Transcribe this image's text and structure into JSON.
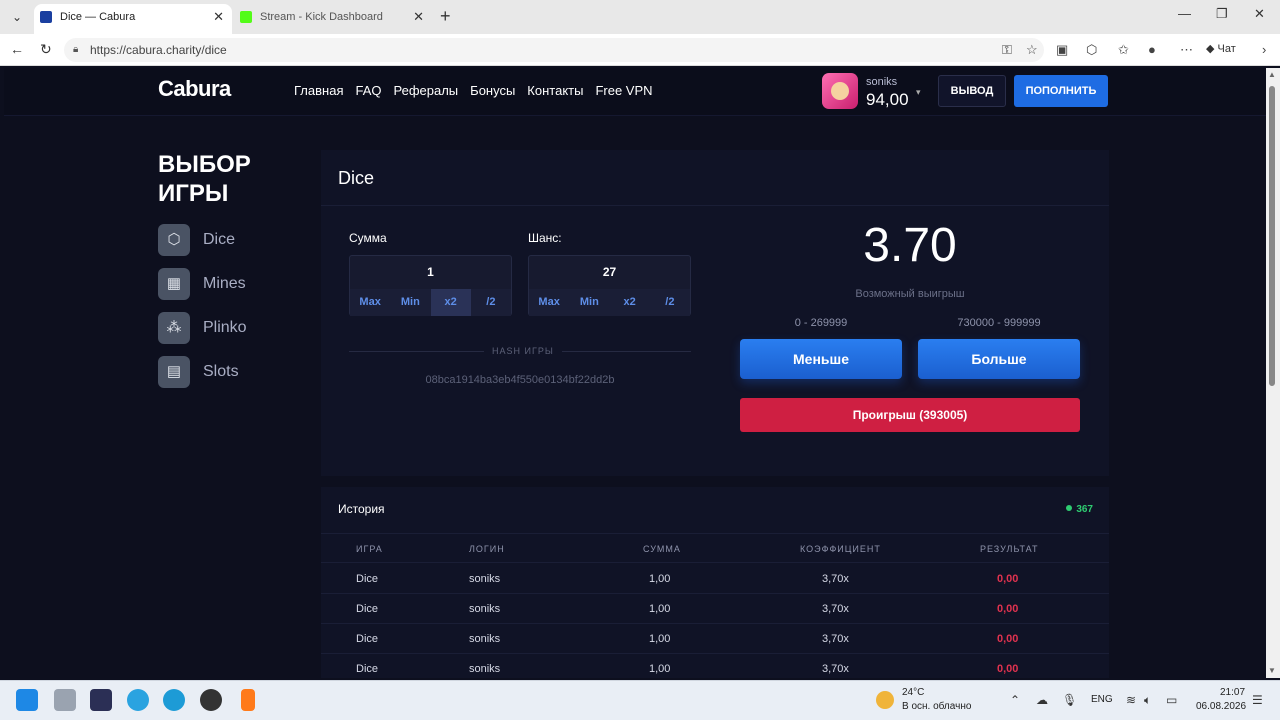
{
  "browser": {
    "tabs": [
      {
        "title": "Dice — Cabura",
        "favicon_color": "#1a3fa0"
      },
      {
        "title": "Stream - Kick Dashboard",
        "favicon_color": "#53fc18"
      }
    ],
    "url": "https://cabura.charity/dice",
    "copilot_label": "Чат"
  },
  "site": {
    "logo": "Cabura",
    "nav": [
      "Главная",
      "FAQ",
      "Рефералы",
      "Бонусы",
      "Контакты",
      "Free VPN"
    ],
    "user": {
      "name": "soniks",
      "balance": "94,00"
    },
    "withdraw_label": "ВЫВОД",
    "deposit_label": "ПОПОЛНИТЬ"
  },
  "sidebar": {
    "title": "ВЫБОР ИГРЫ",
    "games": [
      {
        "label": "Dice",
        "icon": "cube-icon"
      },
      {
        "label": "Mines",
        "icon": "grid-icon"
      },
      {
        "label": "Plinko",
        "icon": "plinko-icon"
      },
      {
        "label": "Slots",
        "icon": "slot-icon"
      }
    ]
  },
  "game": {
    "title": "Dice",
    "sum_label": "Сумма",
    "sum_value": "1",
    "chance_label": "Шанс:",
    "chance_value": "27",
    "ops": [
      "Max",
      "Min",
      "x2",
      "/2"
    ],
    "hash_label": "HASH ИГРЫ",
    "hash_value": "08bca1914ba3eb4f550e0134bf22dd2b",
    "possible_win": "3.70",
    "possible_win_label": "Возможный выигрыш",
    "range_low": "0 - 269999",
    "range_high": "730000 - 999999",
    "less_label": "Меньше",
    "more_label": "Больше",
    "result": "Проигрыш (393005)"
  },
  "history": {
    "title": "История",
    "online": "367",
    "columns": [
      "ИГРА",
      "ЛОГИН",
      "СУММА",
      "КОЭФФИЦИЕНТ",
      "РЕЗУЛЬТАТ"
    ],
    "rows": [
      [
        "Dice",
        "soniks",
        "1,00",
        "3,70x",
        "0,00"
      ],
      [
        "Dice",
        "soniks",
        "1,00",
        "3,70x",
        "0,00"
      ],
      [
        "Dice",
        "soniks",
        "1,00",
        "3,70x",
        "0,00"
      ],
      [
        "Dice",
        "soniks",
        "1,00",
        "3,70x",
        "0,00"
      ]
    ]
  },
  "taskbar": {
    "weather_temp": "24°C",
    "weather_desc": "В осн. облачно",
    "lang": "ENG",
    "time": "21:07",
    "date": "06.08.2026"
  }
}
